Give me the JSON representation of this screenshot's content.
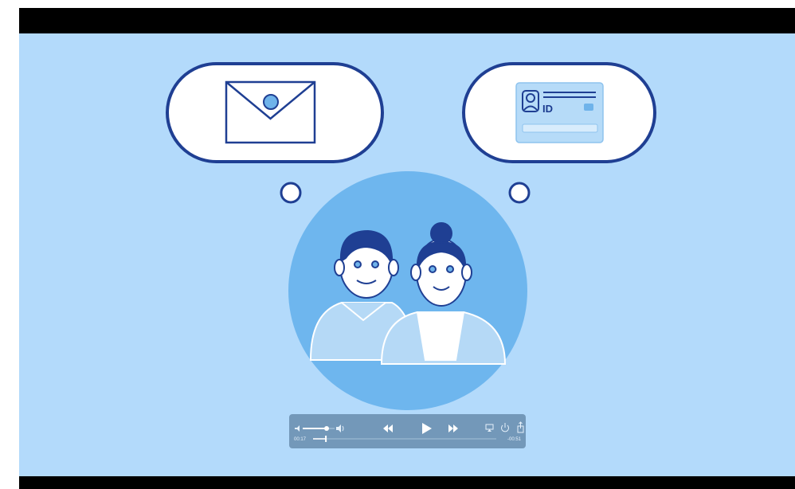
{
  "video": {
    "id_card_text": "ID"
  },
  "player": {
    "current_time": "00:17",
    "remaining_time": "-00:51",
    "progress": 0.07,
    "volume": 0.75,
    "controls": {
      "volume_low_icon": "speaker-low-icon",
      "volume_high_icon": "speaker-high-icon",
      "rewind_icon": "rewind-icon",
      "play_icon": "play-icon",
      "forward_icon": "fast-forward-icon",
      "airplay_icon": "airplay-icon",
      "power_icon": "power-icon",
      "share_icon": "share-icon"
    }
  }
}
